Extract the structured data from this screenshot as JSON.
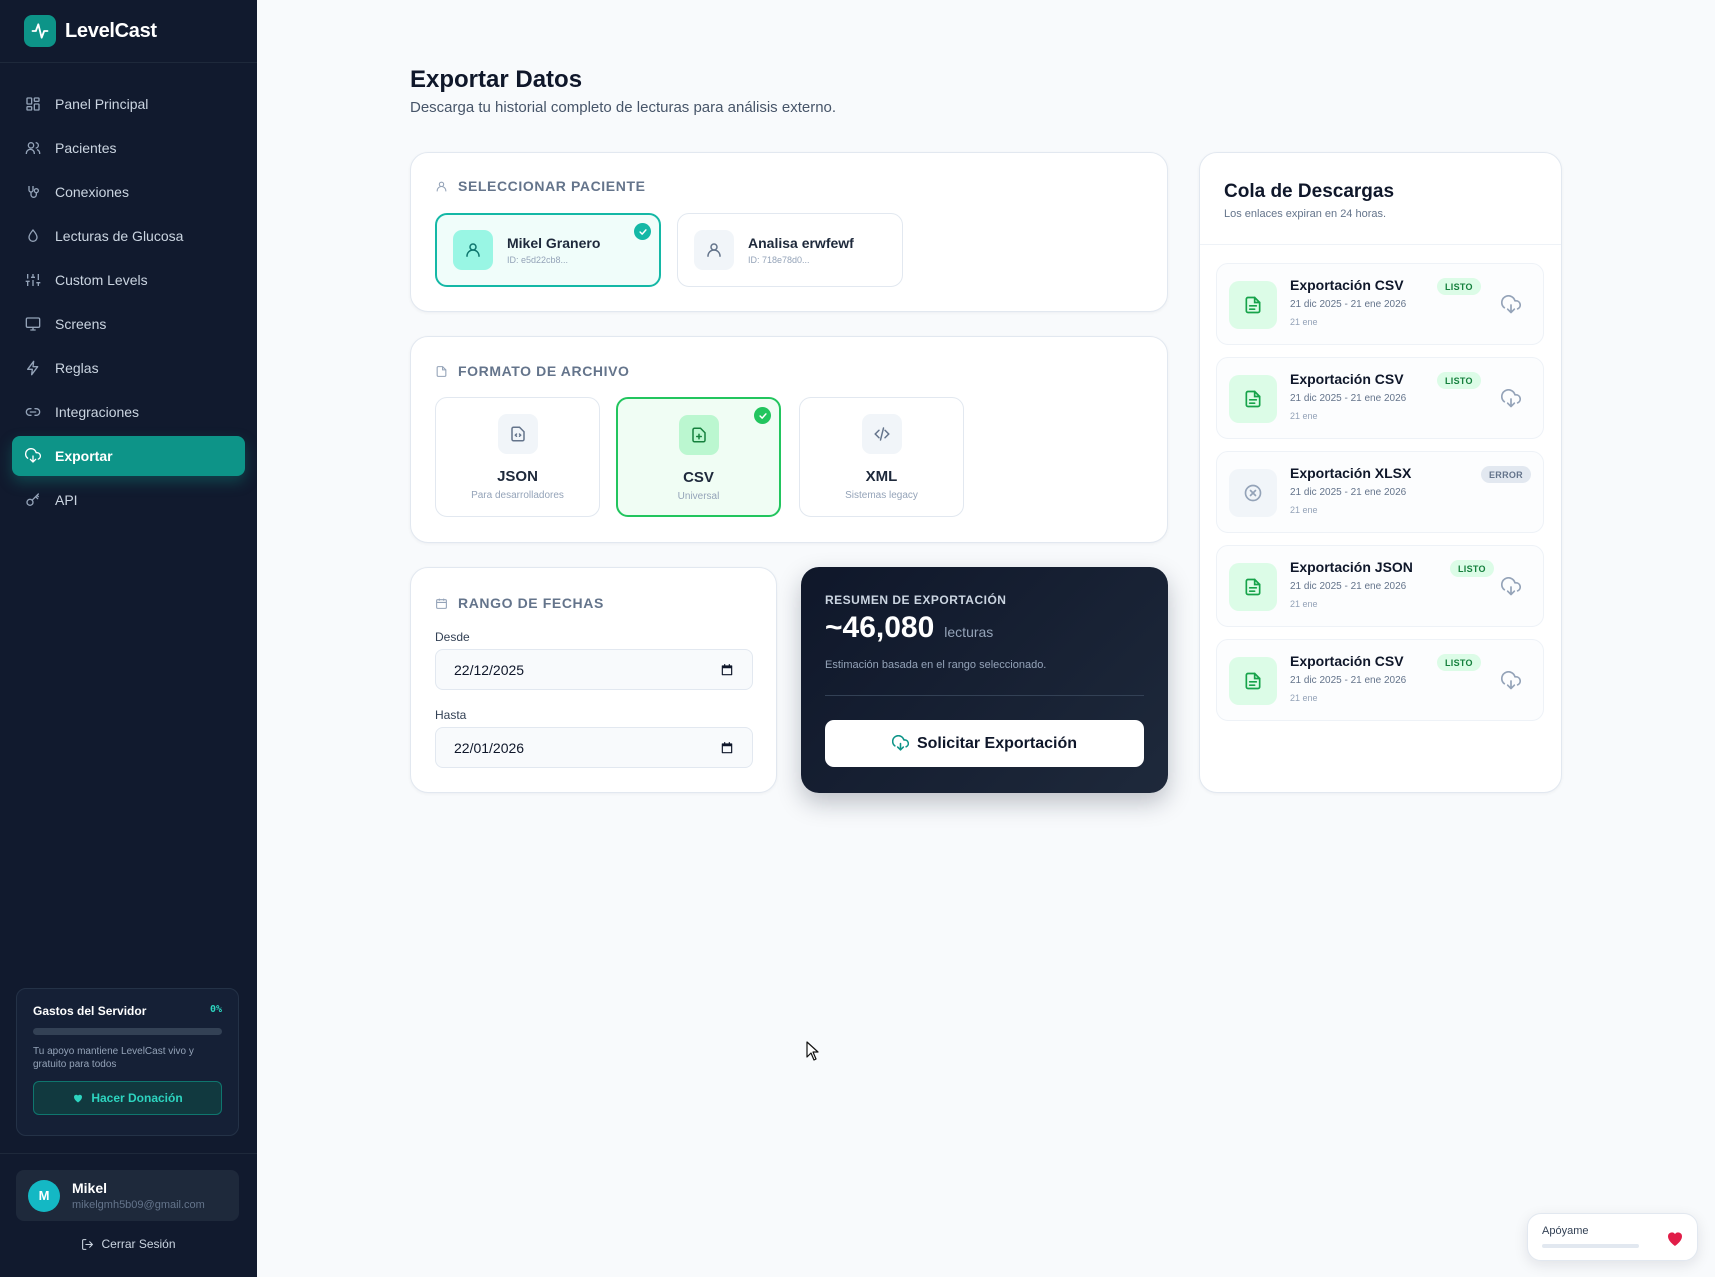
{
  "app": {
    "name": "LevelCast"
  },
  "sidebar": {
    "items": [
      {
        "label": "Panel Principal",
        "icon": "dashboard-icon"
      },
      {
        "label": "Pacientes",
        "icon": "users-icon"
      },
      {
        "label": "Conexiones",
        "icon": "connections-icon"
      },
      {
        "label": "Lecturas de Glucosa",
        "icon": "droplet-icon"
      },
      {
        "label": "Custom Levels",
        "icon": "sliders-icon"
      },
      {
        "label": "Screens",
        "icon": "monitor-icon"
      },
      {
        "label": "Reglas",
        "icon": "bolt-icon"
      },
      {
        "label": "Integraciones",
        "icon": "link-icon"
      },
      {
        "label": "Exportar",
        "icon": "cloud-download-icon",
        "active": true
      },
      {
        "label": "API",
        "icon": "key-icon"
      }
    ],
    "server": {
      "title": "Gastos del Servidor",
      "percent": "0%",
      "progress": 0,
      "text": "Tu apoyo mantiene LevelCast vivo y gratuito para todos",
      "donate_label": "Hacer Donación"
    },
    "user": {
      "initial": "M",
      "name": "Mikel",
      "email": "mikelgmh5b09@gmail.com"
    },
    "logout_label": "Cerrar Sesión"
  },
  "page": {
    "title": "Exportar Datos",
    "subtitle": "Descarga tu historial completo de lecturas para análisis externo."
  },
  "patients": {
    "label": "SELECCIONAR PACIENTE",
    "items": [
      {
        "name": "Mikel Granero",
        "id": "ID: e5d22cb8...",
        "selected": true
      },
      {
        "name": "Analisa erwfewf",
        "id": "ID: 718e78d0...",
        "selected": false
      }
    ]
  },
  "formats": {
    "label": "FORMATO DE ARCHIVO",
    "items": [
      {
        "name": "JSON",
        "desc": "Para desarrolladores",
        "icon": "file-json-icon",
        "selected": false
      },
      {
        "name": "CSV",
        "desc": "Universal",
        "icon": "file-csv-icon",
        "selected": true
      },
      {
        "name": "XML",
        "desc": "Sistemas legacy",
        "icon": "code-icon",
        "selected": false
      }
    ]
  },
  "dates": {
    "label": "RANGO DE FECHAS",
    "from_label": "Desde",
    "from_value": "22/12/2025",
    "to_label": "Hasta",
    "to_value": "22/01/2026"
  },
  "summary": {
    "label": "RESUMEN DE EXPORTACIÓN",
    "value": "~46,080",
    "unit": "lecturas",
    "note": "Estimación basada en el rango seleccionado.",
    "button_label": "Solicitar Exportación"
  },
  "queue": {
    "title": "Cola de Descargas",
    "subtitle": "Los enlaces expiran en 24 horas.",
    "items": [
      {
        "title": "Exportación CSV",
        "range": "21 dic 2025 - 21 ene 2026",
        "date": "21 ene",
        "status": "LISTO"
      },
      {
        "title": "Exportación CSV",
        "range": "21 dic 2025 - 21 ene 2026",
        "date": "21 ene",
        "status": "LISTO"
      },
      {
        "title": "Exportación XLSX",
        "range": "21 dic 2025 - 21 ene 2026",
        "date": "21 ene",
        "status": "ERROR"
      },
      {
        "title": "Exportación JSON",
        "range": "21 dic 2025 - 21 ene 2026",
        "date": "21 ene",
        "status": "LISTO"
      },
      {
        "title": "Exportación CSV",
        "range": "21 dic 2025 - 21 ene 2026",
        "date": "21 ene",
        "status": "LISTO"
      }
    ]
  },
  "support": {
    "label": "Apóyame"
  },
  "colors": {
    "accent": "#0d9488",
    "success": "#22c55e",
    "sidebar": "#111a2e"
  }
}
